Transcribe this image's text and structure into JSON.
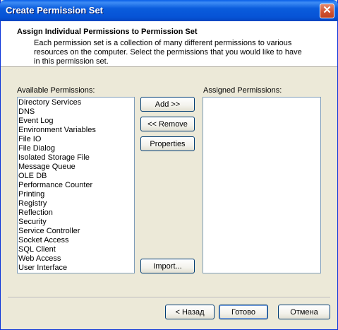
{
  "window": {
    "title": "Create Permission Set",
    "close_glyph": "✕"
  },
  "header": {
    "title": "Assign Individual Permissions to Permission Set",
    "description": "Each permission set is a collection of many different permissions to various resources on the computer.  Select the permissions that you would like to have in this permission set."
  },
  "available": {
    "label": "Available Permissions:",
    "items": [
      "Directory Services",
      "DNS",
      "Event Log",
      "Environment Variables",
      "File IO",
      "File Dialog",
      "Isolated Storage File",
      "Message Queue",
      "OLE DB",
      "Performance Counter",
      "Printing",
      "Registry",
      "Reflection",
      "Security",
      "Service Controller",
      "Socket Access",
      "SQL Client",
      "Web Access",
      "User Interface"
    ]
  },
  "assigned": {
    "label": "Assigned Permissions:",
    "items": []
  },
  "buttons": {
    "add": "Add >>",
    "remove": "<< Remove",
    "properties": "Properties",
    "import": "Import..."
  },
  "footer": {
    "back": "< Назад",
    "finish": "Готово",
    "cancel": "Отмена"
  },
  "colors": {
    "titlebar": "#0a5cdc",
    "close": "#d0512f",
    "face": "#ece9d8",
    "listbox_border": "#7f9db9"
  }
}
